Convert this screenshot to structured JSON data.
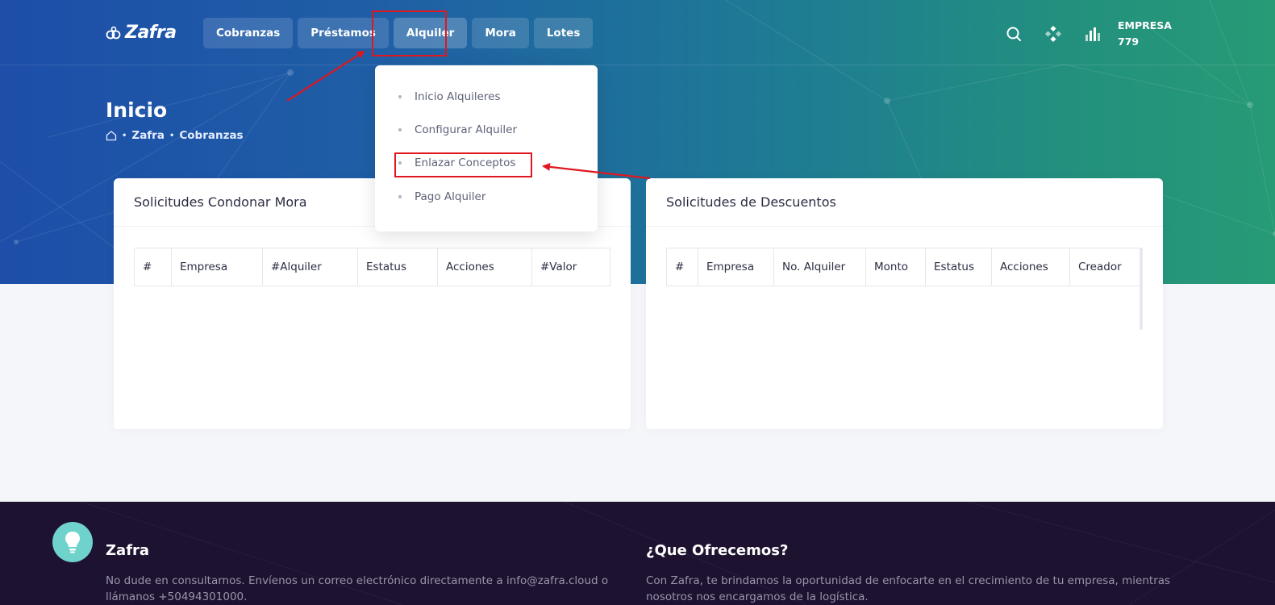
{
  "brand": {
    "name": "Zafra"
  },
  "nav": {
    "items": [
      {
        "label": "Cobranzas"
      },
      {
        "label": "Préstamos"
      },
      {
        "label": "Alquiler"
      },
      {
        "label": "Mora"
      },
      {
        "label": "Lotes"
      }
    ],
    "active": "Alquiler"
  },
  "header": {
    "icons": [
      "search-icon",
      "apps-diamond-icon",
      "bar-chart-icon"
    ],
    "company_label": "EMPRESA",
    "company_id": "779"
  },
  "page": {
    "title": "Inicio",
    "breadcrumb": [
      "Zafra",
      "Cobranzas"
    ]
  },
  "dropdown": {
    "items": [
      {
        "label": "Inicio Alquileres"
      },
      {
        "label": "Configurar Alquiler"
      },
      {
        "label": "Enlazar Conceptos"
      },
      {
        "label": "Pago Alquiler"
      }
    ]
  },
  "cards": {
    "left": {
      "title": "Solicitudes Condonar Mora",
      "columns": [
        "#",
        "Empresa",
        "#Alquiler",
        "Estatus",
        "Acciones",
        "#Valor"
      ]
    },
    "right": {
      "title": "Solicitudes de Descuentos",
      "columns": [
        "#",
        "Empresa",
        "No. Alquiler",
        "Monto",
        "Estatus",
        "Acciones",
        "Creador"
      ]
    }
  },
  "footer": {
    "left": {
      "title": "Zafra",
      "text_line1": "No dude en consultarnos. Envíenos un correo electrónico directamente a info@zafra.cloud o",
      "text_line2": "llámanos +50494301000."
    },
    "right": {
      "title": "¿Que Ofrecemos?",
      "text_line1": "Con Zafra, te brindamos la oportunidad de enfocarte en el crecimiento de tu empresa, mientras",
      "text_line2": "nosotros nos encargamos de la logística."
    }
  },
  "colors": {
    "hero_start": "#1d4ea8",
    "hero_end": "#279a76",
    "annotation_red": "#e0171e",
    "footer_bg": "#1d1230",
    "bulb": "#6fd3cb"
  }
}
